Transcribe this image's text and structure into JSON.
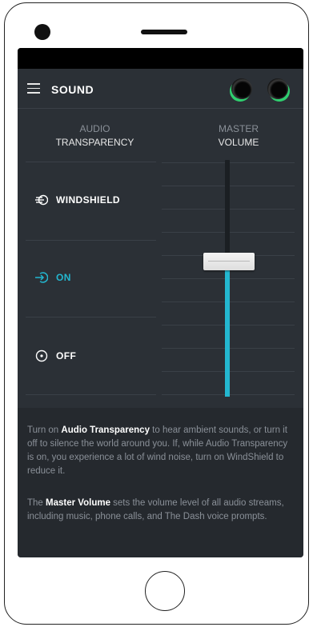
{
  "header": {
    "title": "SOUND"
  },
  "audio_column": {
    "line1": "AUDIO",
    "line2": "TRANSPARENCY"
  },
  "master_column": {
    "line1": "MASTER",
    "line2": "VOLUME"
  },
  "options": [
    {
      "label": "WINDSHIELD",
      "icon": "windshield-icon",
      "selected": false
    },
    {
      "label": "ON",
      "icon": "arrow-in-circle-icon",
      "selected": true
    },
    {
      "label": "OFF",
      "icon": "dot-circle-icon",
      "selected": false
    }
  ],
  "volume": {
    "level": 0.57
  },
  "colors": {
    "accent": "#23b7d0",
    "earbud_glow": "#2fcf6f",
    "background": "#2b3036"
  },
  "help": {
    "p1_pre": "Turn on ",
    "p1_bold": "Audio Transparency",
    "p1_post": " to hear ambient sounds, or turn it off to silence the world around you. If, while Audio Transparency is on, you experience a lot of wind noise, turn on WindShield to reduce it.",
    "p2_pre": "The ",
    "p2_bold": "Master Volume",
    "p2_post": " sets the volume level of all audio streams, including music, phone calls, and The Dash voice prompts."
  }
}
